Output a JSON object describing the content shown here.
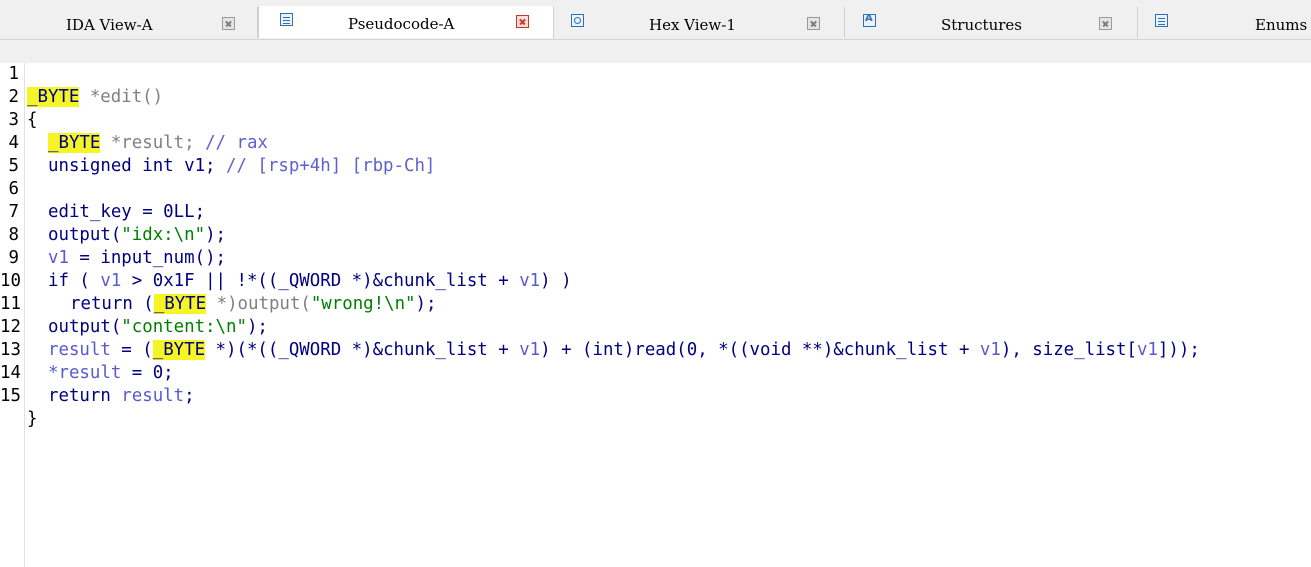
{
  "tabs": [
    {
      "label": "IDA View-A",
      "icon": "ida-view-icon",
      "active": false
    },
    {
      "label": "Pseudocode-A",
      "icon": "pseudocode-icon",
      "active": true
    },
    {
      "label": "Hex View-1",
      "icon": "hex-view-icon",
      "active": false
    },
    {
      "label": "Structures",
      "icon": "structures-icon",
      "active": false
    },
    {
      "label": "Enums",
      "icon": "enums-icon",
      "active": false
    }
  ],
  "code": {
    "line_numbers": [
      "1",
      "2",
      "3",
      "4",
      "5",
      "6",
      "7",
      "8",
      "9",
      "10",
      "11",
      "12",
      "13",
      "14",
      "15"
    ],
    "l1": {
      "t1": "_BYTE",
      "t2": " *edit()"
    },
    "l2": {
      "t1": "{"
    },
    "l3": {
      "t1": "_BYTE",
      "t2": " *result; ",
      "t3": "// rax"
    },
    "l4": {
      "t1": "unsigned int v1; ",
      "t2": "// [rsp+4h] [rbp-Ch]"
    },
    "l6": {
      "t1": "edit_key = 0LL;"
    },
    "l7": {
      "t1": "output(",
      "t2": "\"idx:\\n\"",
      "t3": ");"
    },
    "l8": {
      "t1": "v1",
      "t2": " = input_num();"
    },
    "l9": {
      "t1": "if ( ",
      "t2": "v1",
      "t3": " > 0x1F || !*((_QWORD *)&chunk_list + ",
      "t4": "v1",
      "t5": ") )"
    },
    "l10": {
      "t1": "return (",
      "t2": "_BYTE",
      "t3": " *)output(",
      "t4": "\"wrong!\\n\"",
      "t5": ");"
    },
    "l11": {
      "t1": "output(",
      "t2": "\"content:\\n\"",
      "t3": ");"
    },
    "l12": {
      "t1": "result",
      "t2": " = (",
      "t3": "_BYTE",
      "t4": " *)(*((_QWORD *)&chunk_list + ",
      "t5": "v1",
      "t6": ") + (int)read(0, *((void **)&chunk_list + ",
      "t7": "v1",
      "t8": "), size_list[",
      "t9": "v1",
      "t10": "]));"
    },
    "l13": {
      "t1": "*result",
      "t2": " = 0;"
    },
    "l14": {
      "t1": "return ",
      "t2": "result",
      "t3": ";"
    },
    "l15": {
      "t1": "}"
    }
  },
  "colors": {
    "keyword": "#000080",
    "string": "#008000",
    "variable": "#5a5ad0",
    "highlight": "#f5f525",
    "tab_bar": "#f0f0f0"
  }
}
